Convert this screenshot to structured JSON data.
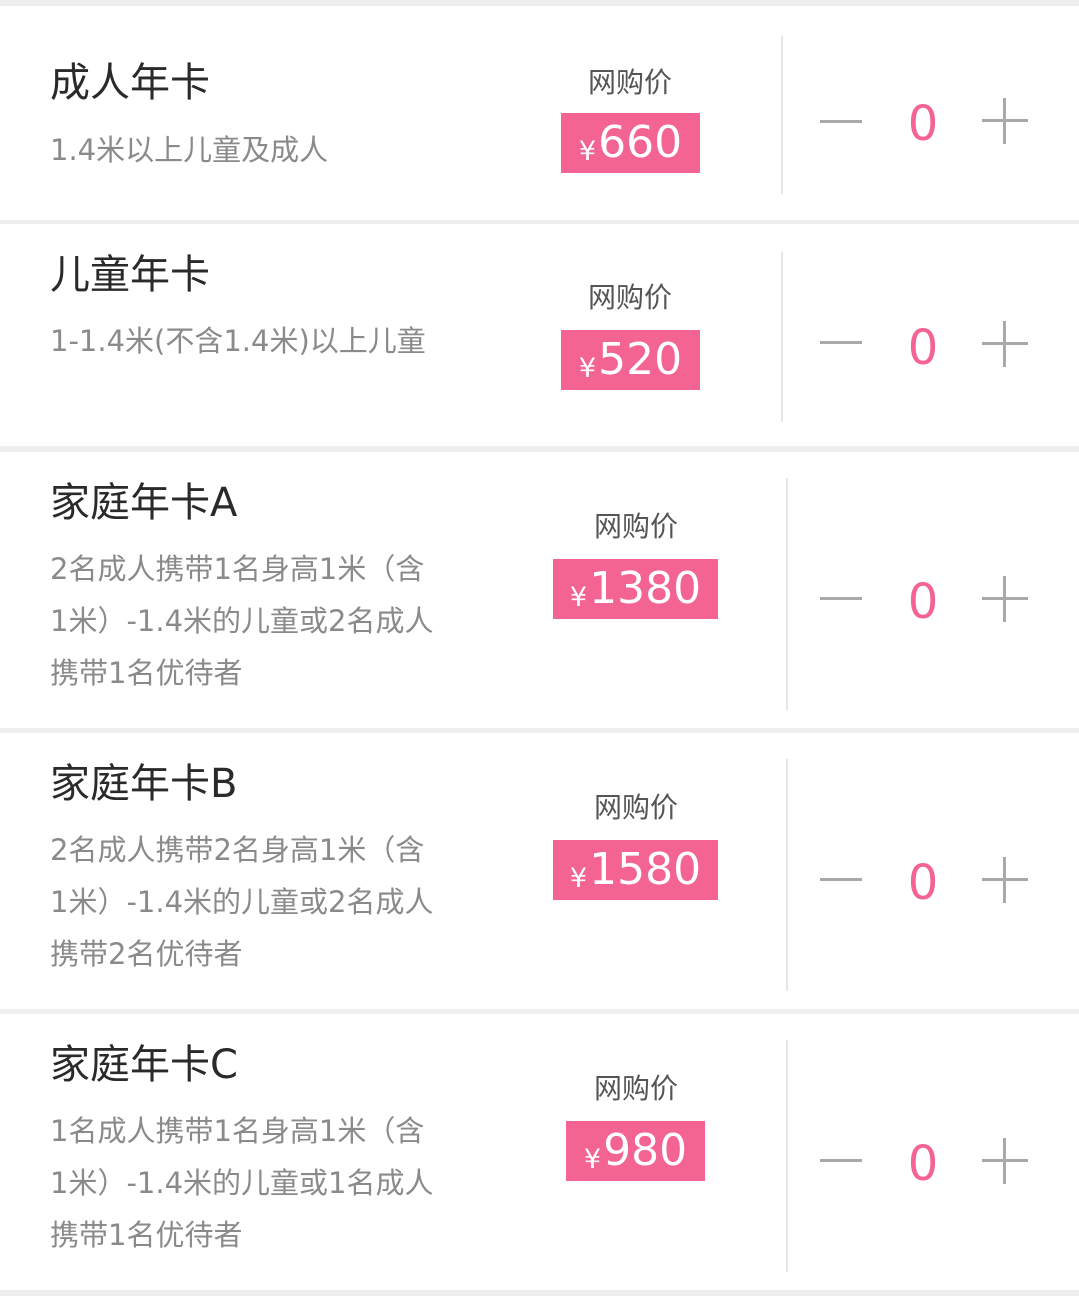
{
  "colors": {
    "accent": "#f46493",
    "page_background": "#eeeeee",
    "card_background": "#ffffff",
    "title_text": "#2a2a2a",
    "description_text": "#8a8a8a",
    "stepper_gray": "#a9a9a9"
  },
  "price_label": "网购价",
  "currency_symbol": "¥",
  "products": [
    {
      "name": "成人年卡",
      "description": "1.4米以上儿童及成人",
      "price": "660",
      "quantity": "0",
      "minus_icon": "minus-icon",
      "plus_icon": "plus-icon"
    },
    {
      "name": "儿童年卡",
      "description": "1-1.4米(不含1.4米)以上儿童",
      "price": "520",
      "quantity": "0",
      "minus_icon": "minus-icon",
      "plus_icon": "plus-icon"
    },
    {
      "name": "家庭年卡A",
      "description": "2名成人携带1名身高1米（含1米）-1.4米的儿童或2名成人携带1名优待者",
      "price": "1380",
      "quantity": "0",
      "minus_icon": "minus-icon",
      "plus_icon": "plus-icon"
    },
    {
      "name": "家庭年卡B",
      "description": "2名成人携带2名身高1米（含1米）-1.4米的儿童或2名成人携带2名优待者",
      "price": "1580",
      "quantity": "0",
      "minus_icon": "minus-icon",
      "plus_icon": "plus-icon"
    },
    {
      "name": "家庭年卡C",
      "description": "1名成人携带1名身高1米（含1米）-1.4米的儿童或1名成人携带1名优待者",
      "price": "980",
      "quantity": "0",
      "minus_icon": "minus-icon",
      "plus_icon": "plus-icon"
    }
  ]
}
